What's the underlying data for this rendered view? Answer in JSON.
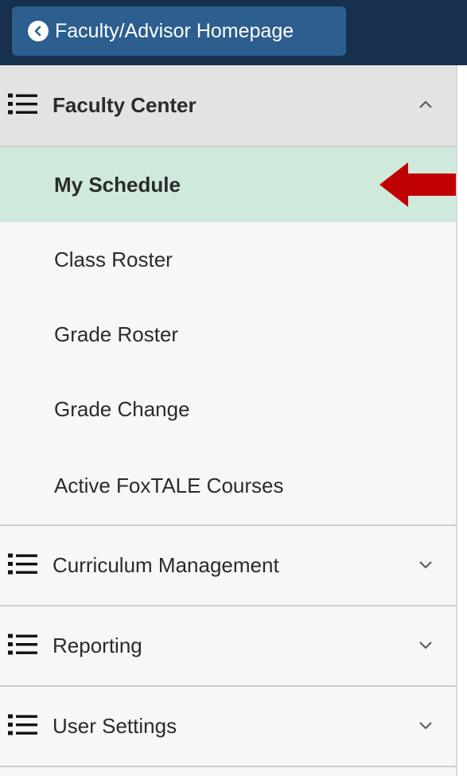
{
  "header": {
    "back_label": "Faculty/Advisor Homepage"
  },
  "nav": {
    "faculty_center": {
      "label": "Faculty Center",
      "items": [
        {
          "label": "My Schedule",
          "active": true
        },
        {
          "label": "Class Roster"
        },
        {
          "label": "Grade Roster"
        },
        {
          "label": "Grade Change"
        },
        {
          "label": "Active FoxTALE Courses"
        }
      ]
    },
    "sections": [
      {
        "label": "Curriculum Management"
      },
      {
        "label": "Reporting"
      },
      {
        "label": "User Settings"
      }
    ]
  },
  "colors": {
    "header_bg": "#16304d",
    "back_button_bg": "#2c5e8f",
    "active_item_bg": "#cfeadb",
    "expanded_header_bg": "#e3e3e3",
    "pointer_arrow": "#c00000"
  },
  "icons": {
    "back": "chevron-left-icon",
    "section": "list-icon",
    "expanded": "chevron-up-icon",
    "collapsed": "chevron-down-icon",
    "pointer": "arrow-left-icon"
  }
}
